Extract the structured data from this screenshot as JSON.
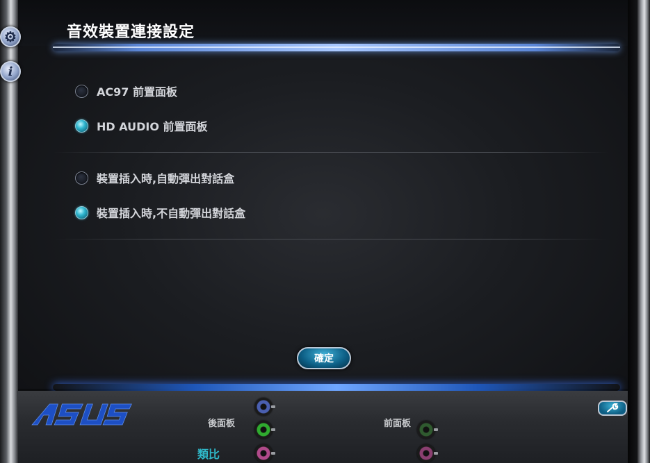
{
  "window": {
    "title": "音效裝置連接設定"
  },
  "side_icons": {
    "settings_icon": "gear-icon",
    "info_icon": "info-icon",
    "info_glyph": "i",
    "gear_glyph": "⚙"
  },
  "front_panel_group": {
    "options": [
      {
        "label": "AC97 前置面板",
        "selected": false
      },
      {
        "label": "HD AUDIO 前置面板",
        "selected": true
      }
    ]
  },
  "popup_group": {
    "options": [
      {
        "label": "裝置插入時,自動彈出對話盒",
        "selected": false
      },
      {
        "label": "裝置插入時,不自動彈出對話盒",
        "selected": true
      }
    ]
  },
  "ok_button": {
    "label": "確定"
  },
  "footer": {
    "logo": "/ISUS",
    "back_panel_label": "後面板",
    "front_panel_label": "前面板",
    "analog_label": "類比",
    "tool_icon": "wrench-icon",
    "jack_colors": {
      "blue": "#4a5fb0",
      "green": "#2faa2f",
      "pink": "#b04a8a",
      "dark_green": "#2f5a2f"
    }
  },
  "colors": {
    "accent": "#2fb6cf",
    "logo_blue": "#1d4fc4",
    "analog": "#2fb7c7"
  }
}
